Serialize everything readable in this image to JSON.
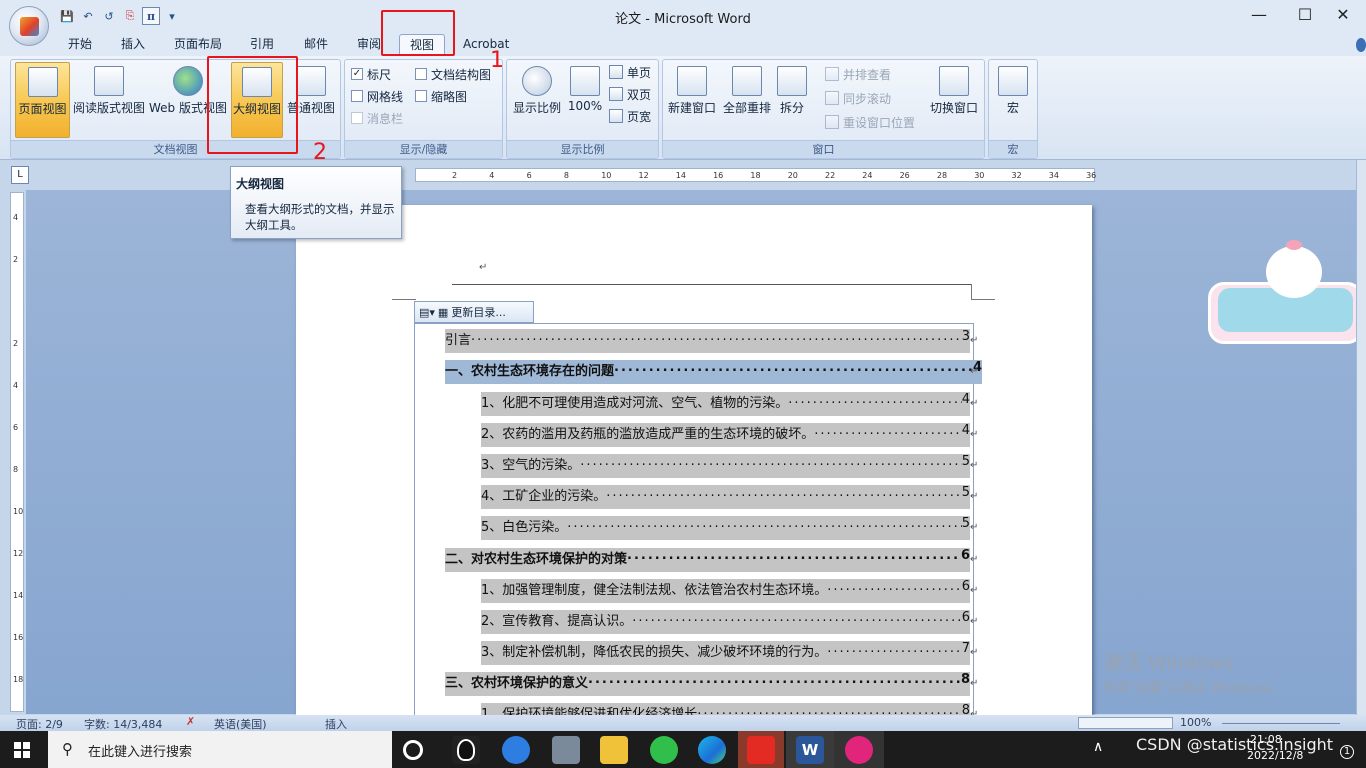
{
  "window": {
    "title": "论文 - Microsoft Word",
    "minimize": "—",
    "maximize": "☐",
    "close": "✕"
  },
  "qat": {
    "save": "💾",
    "undo": "↶",
    "redo": "↺",
    "pdf": "⎘",
    "pi": "π",
    "more": "▾"
  },
  "tabs": [
    "开始",
    "插入",
    "页面布局",
    "引用",
    "邮件",
    "审阅",
    "视图",
    "Acrobat"
  ],
  "active_tab": "视图",
  "ribbon": {
    "doc_views": {
      "label": "文档视图",
      "buttons": [
        "页面视图",
        "阅读版式视图",
        "Web 版式视图",
        "大纲视图",
        "普通视图"
      ]
    },
    "show_hide": {
      "label": "显示/隐藏",
      "items": [
        {
          "label": "标尺",
          "checked": true
        },
        {
          "label": "文档结构图",
          "checked": false
        },
        {
          "label": "网格线",
          "checked": false
        },
        {
          "label": "缩略图",
          "checked": false
        },
        {
          "label": "消息栏",
          "checked": false,
          "disabled": true
        }
      ]
    },
    "zoom": {
      "label": "显示比例",
      "zoom_btn": "显示比例",
      "pct_btn": "100%",
      "one_page": "单页",
      "two_pages": "双页",
      "page_width": "页宽"
    },
    "window": {
      "label": "窗口",
      "new": "新建窗口",
      "arrange": "全部重排",
      "split": "拆分",
      "side_by_side": "并排查看",
      "sync_scroll": "同步滚动",
      "reset_pos": "重设窗口位置",
      "switch": "切换窗口"
    },
    "macro": {
      "label": "宏",
      "button": "宏"
    }
  },
  "annotations": {
    "marker1": "1",
    "marker2": "2"
  },
  "tooltip": {
    "title": "大纲视图",
    "body": "查看大纲形式的文档，并显示大纲工具。"
  },
  "ruler": {
    "ticks": [
      "2",
      "4",
      "6",
      "8",
      "10",
      "12",
      "14",
      "16",
      "18",
      "20",
      "22",
      "24",
      "26",
      "28",
      "30",
      "32",
      "34",
      "36"
    ]
  },
  "vruler": {
    "ticks": [
      "4",
      "2",
      "",
      "2",
      "4",
      "6",
      "8",
      "10",
      "12",
      "14",
      "16",
      "18"
    ]
  },
  "toc_toolbar": {
    "update": "更新目录..."
  },
  "toc": [
    {
      "text": "引言",
      "page": "3",
      "level": 0
    },
    {
      "text": "一、农村生态环境存在的问题",
      "page": "4",
      "level": 0,
      "bold": true,
      "selected": true
    },
    {
      "text": "1、化肥不可理使用造成对河流、空气、植物的污染。",
      "page": "4",
      "level": 1
    },
    {
      "text": "2、农药的滥用及药瓶的滥放造成严重的生态环境的破坏。",
      "page": "4",
      "level": 1
    },
    {
      "text": "3、空气的污染。",
      "page": "5",
      "level": 1
    },
    {
      "text": "4、工矿企业的污染。",
      "page": "5",
      "level": 1
    },
    {
      "text": "5、白色污染。",
      "page": "5",
      "level": 1
    },
    {
      "text": "二、对农村生态环境保护的对策",
      "page": "6",
      "level": 0,
      "bold": true
    },
    {
      "text": "1、加强管理制度，健全法制法规、依法管治农村生态环境。",
      "page": "6",
      "level": 1
    },
    {
      "text": "2、宣传教育、提高认识。",
      "page": "6",
      "level": 1
    },
    {
      "text": "3、制定补偿机制，降低农民的损失、减少破坏环境的行为。",
      "page": "7",
      "level": 1
    },
    {
      "text": "三、农村环境保护的意义",
      "page": "8",
      "level": 0,
      "bold": true
    },
    {
      "text": "1、保护环境能够促进和优化经济增长",
      "page": "8",
      "level": 1
    }
  ],
  "statusbar": {
    "page": "页面: 2/9",
    "words": "字数: 14/3,484",
    "lang": "英语(美国)",
    "mode": "插入",
    "zoom": "100%"
  },
  "taskbar": {
    "search_placeholder": "在此键入进行搜索",
    "time": "21:08",
    "date": "2022/12/8",
    "csdn": "CSDN @statistics.insight",
    "notif": "1"
  },
  "activation": {
    "line1": "激活 Windows",
    "line2": "转到\"设置\"以激活 Windows。"
  },
  "colors": {
    "ribbon_bg": "#dfe9f6",
    "selected_btn": "#f7c64e",
    "annotation_red": "#e8151b",
    "doc_bg": "#86a5cf",
    "toc_shading": "#c4c4c4"
  }
}
